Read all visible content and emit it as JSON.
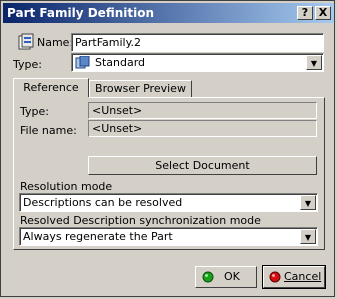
{
  "window": {
    "title": "Part Family Definition"
  },
  "titlebar_buttons": {
    "help": "?",
    "close": "X"
  },
  "name": {
    "label": "Name:",
    "value": "PartFamily.2"
  },
  "type": {
    "label": "Type:",
    "value": "Standard"
  },
  "tabs": [
    {
      "label": "Reference",
      "active": true
    },
    {
      "label": "Browser Preview",
      "active": false
    }
  ],
  "reference": {
    "type_label": "Type:",
    "type_value": "<Unset>",
    "file_label": "File name:",
    "file_value": "<Unset>",
    "select_button": "Select Document",
    "resolution_label": "Resolution mode",
    "resolution_value": "Descriptions can be resolved",
    "sync_label": "Resolved Description synchronization mode",
    "sync_value": "Always regenerate the Part"
  },
  "footer": {
    "ok": "OK",
    "cancel": "Cancel"
  },
  "colors": {
    "title_start": "#0a246a",
    "title_end": "#a6caf0",
    "dialog_bg": "#d4d0c8",
    "ok_icon": "#1aa01a",
    "cancel_icon": "#d01010"
  },
  "icons": [
    "catalog-icon",
    "standard-part-icon",
    "help-icon",
    "close-icon",
    "ok-icon",
    "cancel-icon",
    "dropdown-arrow-icon"
  ]
}
